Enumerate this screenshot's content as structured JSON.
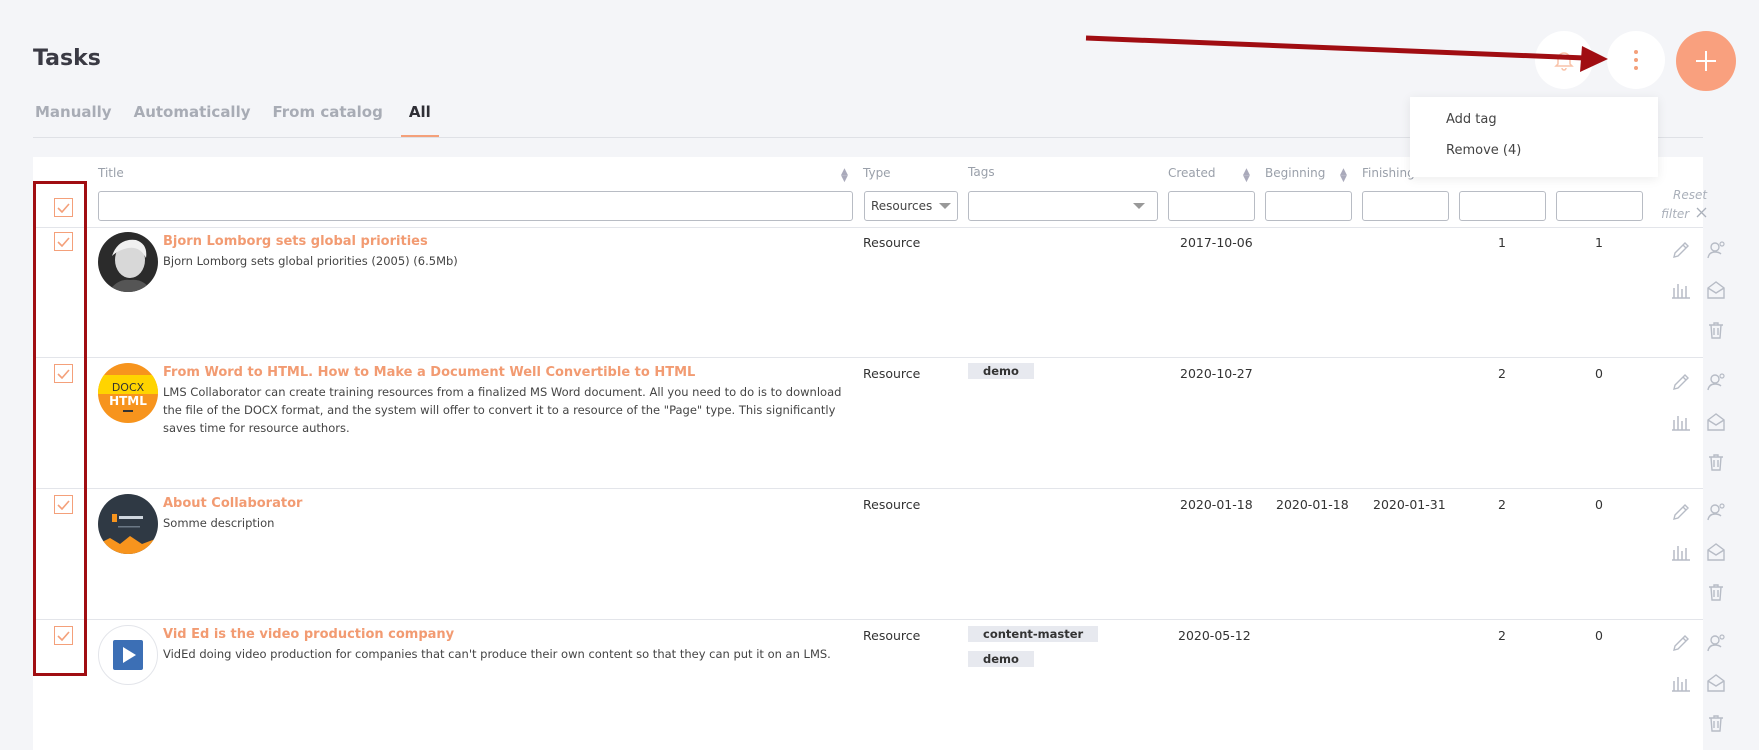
{
  "page": {
    "title": "Tasks"
  },
  "tabs": [
    "Manually",
    "Automatically",
    "From catalog",
    "All"
  ],
  "active_tab": "All",
  "dropdown": {
    "items": [
      "Add tag",
      "Remove (4)"
    ]
  },
  "columns": {
    "title": "Title",
    "type": "Type",
    "tags": "Tags",
    "created": "Created",
    "beginning": "Beginning",
    "finishing": "Finishing"
  },
  "filters": {
    "type_value": "Resources",
    "reset_line1": "Reset",
    "reset_line2": "filter"
  },
  "rows": [
    {
      "title": "Bjorn Lomborg sets global priorities",
      "description": "Bjorn Lomborg sets global priorities (2005) (6.5Mb)",
      "type": "Resource",
      "tags": [],
      "created": "2017-10-06",
      "beginning": "",
      "finishing": "",
      "count1": "1",
      "count2": "1",
      "avatar": "person-portrait"
    },
    {
      "title": "From Word to HTML. How to Make a Document Well Convertible to HTML",
      "description": "LMS Collaborator can create training resources from a finalized MS Word document. All you need to do is to download the file of the DOCX format, and the system will offer to convert it to a resource of the \"Page\" type. This significantly saves time for resource authors.",
      "type": "Resource",
      "tags": [
        "demo"
      ],
      "created": "2020-10-27",
      "beginning": "",
      "finishing": "",
      "count1": "2",
      "count2": "0",
      "avatar": "docx-html-logo",
      "avatar_text1": "DOCX",
      "avatar_text2": "HTML"
    },
    {
      "title": "About Collaborator",
      "description": "Somme description",
      "type": "Resource",
      "tags": [],
      "created": "2020-01-18",
      "beginning": "2020-01-18",
      "finishing": "2020-01-31",
      "count1": "2",
      "count2": "0",
      "avatar": "collaborator-logo"
    },
    {
      "title": "Vid Ed is the video production company",
      "description": "VidEd doing video production for companies that can't produce their own content so that they can put it on an LMS.",
      "type": "Resource",
      "tags": [
        "content-master",
        "demo"
      ],
      "created": "2020-05-12",
      "beginning": "",
      "finishing": "",
      "count1": "2",
      "count2": "0",
      "avatar": "video-play-logo"
    }
  ],
  "colors": {
    "accent": "#f29b72",
    "add_button": "#f9a07e",
    "highlight": "#a00d12"
  }
}
